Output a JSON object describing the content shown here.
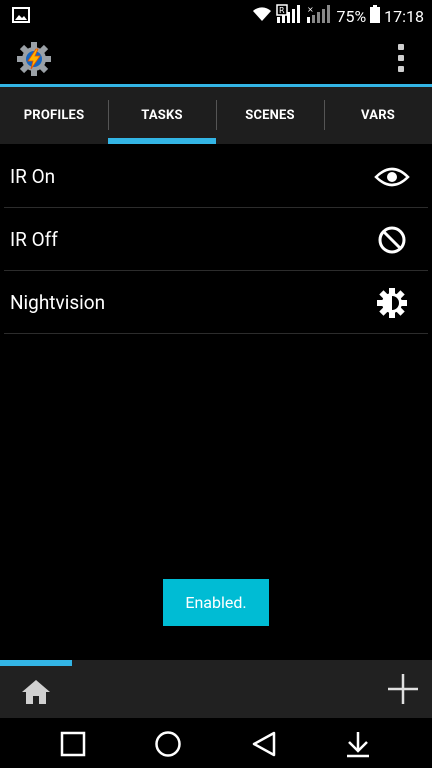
{
  "status_bar": {
    "battery_text": "75%",
    "time": "17:18",
    "icons": [
      "image-notification-icon",
      "wifi-icon",
      "signal-r-icon",
      "signal-x-icon",
      "battery-icon"
    ]
  },
  "app_bar": {
    "app_icon": "tasker-gear-bolt-icon",
    "overflow_icon": "more-vert-icon"
  },
  "tabs": [
    {
      "label": "PROFILES",
      "active": false
    },
    {
      "label": "TASKS",
      "active": true
    },
    {
      "label": "SCENES",
      "active": false
    },
    {
      "label": "VARS",
      "active": false
    }
  ],
  "tasks": [
    {
      "label": "IR On",
      "icon": "eye-icon"
    },
    {
      "label": "IR Off",
      "icon": "block-icon"
    },
    {
      "label": "Nightvision",
      "icon": "brightness-icon"
    }
  ],
  "toast": {
    "text": "Enabled."
  },
  "bottom_bar": {
    "home_icon": "home-icon",
    "add_icon": "plus-icon"
  },
  "nav_bar": {
    "icons": [
      "square-recents-icon",
      "circle-home-icon",
      "triangle-back-icon",
      "down-arrow-icon"
    ]
  },
  "colors": {
    "accent": "#33b5e5",
    "toast": "#00bcd4",
    "tab_bar": "#1e1e1e",
    "bottom_bar": "#212121"
  }
}
